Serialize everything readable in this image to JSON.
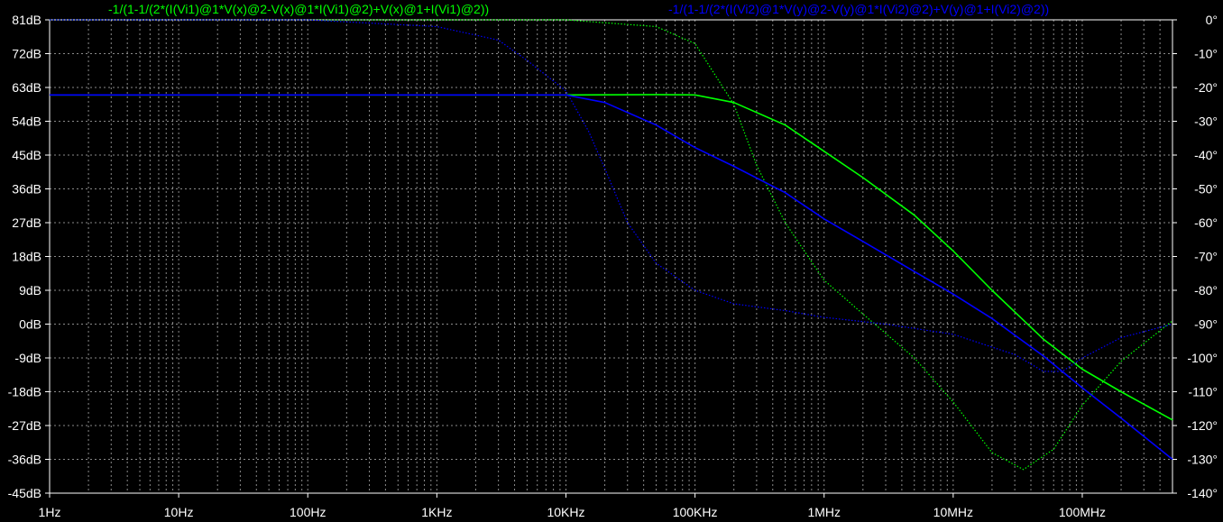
{
  "chart_data": {
    "type": "line",
    "x_scale": "log",
    "xlim": [
      1,
      500000000
    ],
    "x_ticks": [
      {
        "value": 1,
        "label": "1Hz"
      },
      {
        "value": 10,
        "label": "10Hz"
      },
      {
        "value": 100,
        "label": "100Hz"
      },
      {
        "value": 1000,
        "label": "1KHz"
      },
      {
        "value": 10000,
        "label": "10KHz"
      },
      {
        "value": 100000,
        "label": "100KHz"
      },
      {
        "value": 1000000,
        "label": "1MHz"
      },
      {
        "value": 10000000,
        "label": "10MHz"
      },
      {
        "value": 100000000,
        "label": "100MHz"
      }
    ],
    "y_left": {
      "ylim": [
        -45,
        81
      ],
      "ticks": [
        {
          "value": 81,
          "label": "81dB"
        },
        {
          "value": 72,
          "label": "72dB"
        },
        {
          "value": 63,
          "label": "63dB"
        },
        {
          "value": 54,
          "label": "54dB"
        },
        {
          "value": 45,
          "label": "45dB"
        },
        {
          "value": 36,
          "label": "36dB"
        },
        {
          "value": 27,
          "label": "27dB"
        },
        {
          "value": 18,
          "label": "18dB"
        },
        {
          "value": 9,
          "label": "9dB"
        },
        {
          "value": 0,
          "label": "0dB"
        },
        {
          "value": -9,
          "label": "-9dB"
        },
        {
          "value": -18,
          "label": "-18dB"
        },
        {
          "value": -27,
          "label": "-27dB"
        },
        {
          "value": -36,
          "label": "-36dB"
        },
        {
          "value": -45,
          "label": "-45dB"
        }
      ]
    },
    "y_right": {
      "ylim": [
        -140,
        0
      ],
      "ticks": [
        {
          "value": 0,
          "label": "0°"
        },
        {
          "value": -10,
          "label": "-10°"
        },
        {
          "value": -20,
          "label": "-20°"
        },
        {
          "value": -30,
          "label": "-30°"
        },
        {
          "value": -40,
          "label": "-40°"
        },
        {
          "value": -50,
          "label": "-50°"
        },
        {
          "value": -60,
          "label": "-60°"
        },
        {
          "value": -70,
          "label": "-70°"
        },
        {
          "value": -80,
          "label": "-80°"
        },
        {
          "value": -90,
          "label": "-90°"
        },
        {
          "value": -100,
          "label": "-100°"
        },
        {
          "value": -110,
          "label": "-110°"
        },
        {
          "value": -120,
          "label": "-120°"
        },
        {
          "value": -130,
          "label": "-130°"
        },
        {
          "value": -140,
          "label": "-140°"
        }
      ]
    },
    "grid": true,
    "background": "#000000",
    "series": [
      {
        "name": "-1/(1-1/(2*(I(Vi1)@1*V(x)@2-V(x)@1*I(Vi1)@2)+V(x)@1+I(Vi1)@2))",
        "color": "#00ff00",
        "magnitude": {
          "axis": "left",
          "style": "solid",
          "points": [
            [
              1,
              61
            ],
            [
              10000,
              61
            ],
            [
              50000,
              61.1
            ],
            [
              100000,
              61
            ],
            [
              200000,
              59
            ],
            [
              500000,
              53
            ],
            [
              1000000,
              46
            ],
            [
              2000000,
              39
            ],
            [
              5000000,
              29
            ],
            [
              10000000,
              19.5
            ],
            [
              20000000,
              9
            ],
            [
              50000000,
              -4
            ],
            [
              100000000,
              -12
            ],
            [
              200000000,
              -18
            ],
            [
              500000000,
              -25.5
            ]
          ]
        },
        "phase": {
          "axis": "right",
          "style": "dotted",
          "points": [
            [
              1,
              0
            ],
            [
              10000,
              0
            ],
            [
              50000,
              -2
            ],
            [
              100000,
              -7
            ],
            [
              200000,
              -25
            ],
            [
              300000,
              -43
            ],
            [
              500000,
              -60
            ],
            [
              1000000,
              -77
            ],
            [
              2000000,
              -87
            ],
            [
              5000000,
              -100
            ],
            [
              10000000,
              -113
            ],
            [
              20000000,
              -128
            ],
            [
              35000000,
              -133
            ],
            [
              60000000,
              -127
            ],
            [
              100000000,
              -114
            ],
            [
              200000000,
              -101
            ],
            [
              500000000,
              -89
            ]
          ]
        }
      },
      {
        "name": "-1/(1-1/(2*(I(Vi2)@1*V(y)@2-V(y)@1*I(Vi2)@2)+V(y)@1+I(Vi2)@2))",
        "color": "#0000ff",
        "magnitude": {
          "axis": "left",
          "style": "solid",
          "points": [
            [
              1,
              61
            ],
            [
              5000,
              61
            ],
            [
              10000,
              61
            ],
            [
              20000,
              59
            ],
            [
              50000,
              53
            ],
            [
              100000,
              47
            ],
            [
              200000,
              42
            ],
            [
              500000,
              35
            ],
            [
              1000000,
              28
            ],
            [
              2000000,
              22
            ],
            [
              5000000,
              14
            ],
            [
              10000000,
              8
            ],
            [
              20000000,
              1.5
            ],
            [
              50000000,
              -8.5
            ],
            [
              100000000,
              -17
            ],
            [
              200000000,
              -25
            ],
            [
              500000000,
              -36
            ]
          ]
        },
        "phase": {
          "axis": "right",
          "style": "dotted",
          "points": [
            [
              1,
              0
            ],
            [
              10,
              0
            ],
            [
              100,
              0
            ],
            [
              1000,
              -2
            ],
            [
              3000,
              -6
            ],
            [
              5000,
              -12
            ],
            [
              10000,
              -21
            ],
            [
              15000,
              -33
            ],
            [
              20000,
              -44
            ],
            [
              30000,
              -60
            ],
            [
              50000,
              -72
            ],
            [
              100000,
              -80
            ],
            [
              200000,
              -84
            ],
            [
              500000,
              -86
            ],
            [
              1000000,
              -88
            ],
            [
              3000000,
              -90
            ],
            [
              10000000,
              -93
            ],
            [
              30000000,
              -99
            ],
            [
              50000000,
              -104
            ],
            [
              70000000,
              -104
            ],
            [
              100000000,
              -100
            ],
            [
              200000000,
              -94
            ],
            [
              500000000,
              -90
            ]
          ]
        }
      }
    ]
  }
}
